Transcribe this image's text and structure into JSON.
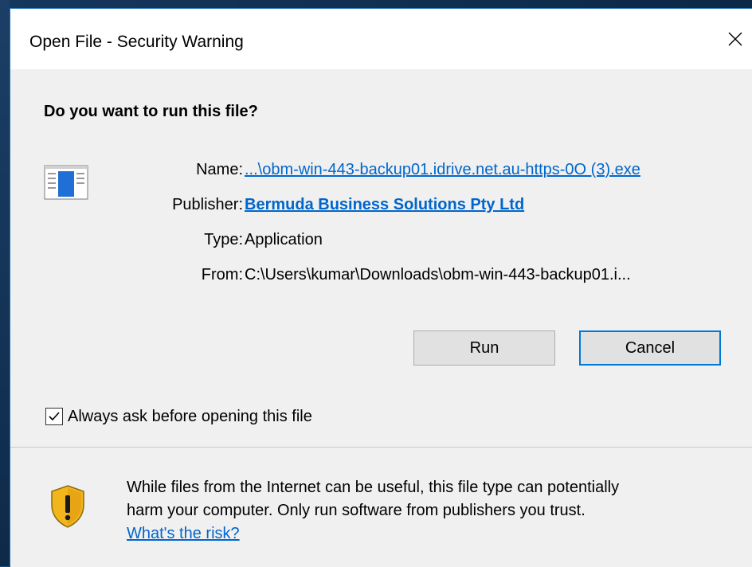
{
  "window": {
    "title": "Open File - Security Warning",
    "close_glyph": "✕"
  },
  "dialog": {
    "question": "Do you want to run this file?",
    "fields": {
      "name_label": "Name:",
      "name_value": "...\\obm-win-443-backup01.idrive.net.au-https-0O (3).exe",
      "publisher_label": "Publisher:",
      "publisher_value": "Bermuda Business Solutions Pty Ltd",
      "type_label": "Type:",
      "type_value": "Application",
      "from_label": "From:",
      "from_value": "C:\\Users\\kumar\\Downloads\\obm-win-443-backup01.i..."
    },
    "buttons": {
      "run_label": "Run",
      "cancel_label": "Cancel"
    },
    "checkbox": {
      "label": "Always ask before opening this file",
      "checked": true
    }
  },
  "warning": {
    "message_line1": "While files from the Internet can be useful, this file type can potentially",
    "message_line2": "harm your computer. Only run software from publishers you trust.",
    "risk_link": "What's the risk?"
  },
  "icons": {
    "file": "application-file-icon",
    "shield": "warning-shield-icon",
    "close": "close-icon",
    "check": "checkmark-icon"
  },
  "colors": {
    "link": "#0066cc",
    "accent_border": "#0078d7",
    "dialog_bg": "#f0f0f0",
    "titlebar_bg": "#ffffff",
    "shield_yellow": "#f2b51b"
  }
}
